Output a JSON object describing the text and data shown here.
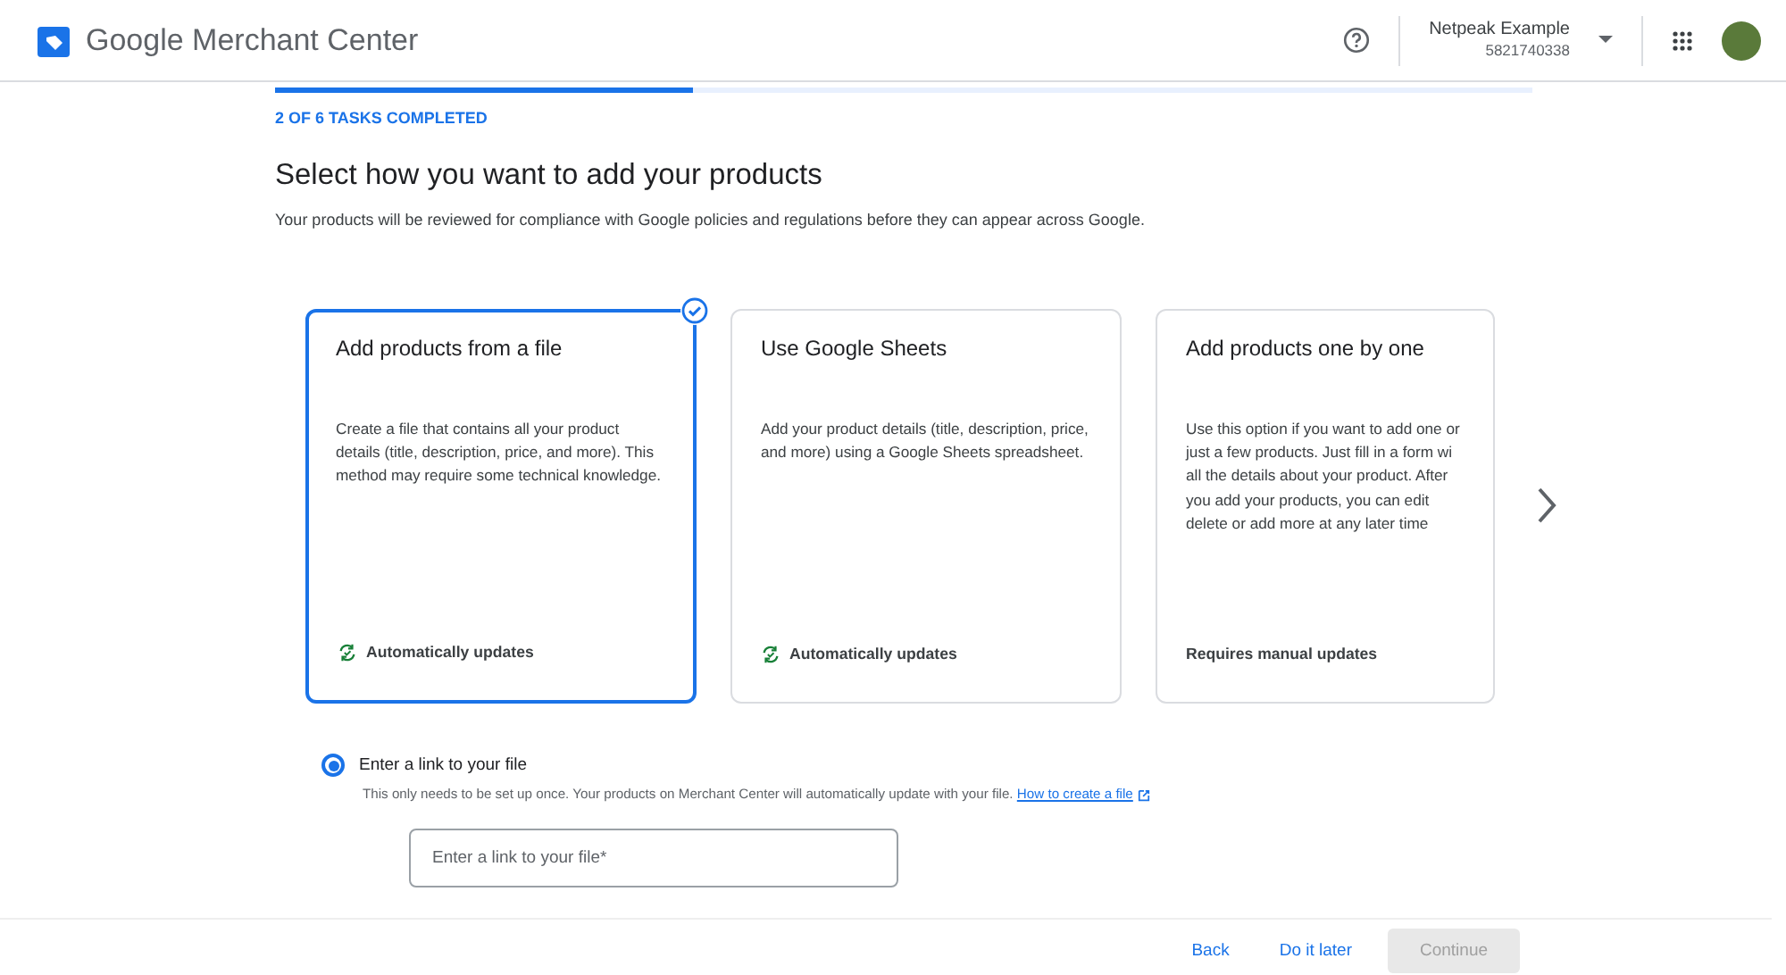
{
  "header": {
    "app_name": "Google Merchant Center",
    "account_name": "Netpeak Example",
    "account_id": "5821740338"
  },
  "progress": {
    "level": 0.333,
    "label": "2 OF 6 TASKS COMPLETED"
  },
  "title": "Select how you want to add your products",
  "subtitle": "Your products will be reviewed for compliance with Google policies and regulations before they can appear across Google.",
  "options": [
    {
      "title": "Add products from a file",
      "description": "Create a file that contains all your product details (title, description, price, and more). This method may require some technical knowledge.",
      "footer": "Automatically updates",
      "auto": true,
      "selected": true
    },
    {
      "title": "Use Google Sheets",
      "description": "Add your product details (title, description, price, and more) using a Google Sheets spreadsheet.",
      "footer": "Automatically updates",
      "auto": true,
      "selected": false
    },
    {
      "title": "Add products one by one",
      "description": "Use this option if you want to add one or\njust a few products. Just fill in a form wi\nall the details about your product. After\nyou add your products, you can edit\ndelete or add more at any later time",
      "footer": "Requires manual updates",
      "auto": false,
      "selected": false
    }
  ],
  "radio": {
    "label": "Enter a link to your file",
    "selected": true,
    "help": "This only needs to be set up once. Your products on Merchant Center will automatically update with your file.",
    "link": "How to create a file"
  },
  "field": {
    "placeholder": "Enter a link to your file*"
  },
  "footer_buttons": [
    {
      "label": "Back",
      "disabled": false
    },
    {
      "label": "Do it later",
      "disabled": false
    },
    {
      "label": "Continue",
      "disabled": true
    }
  ]
}
